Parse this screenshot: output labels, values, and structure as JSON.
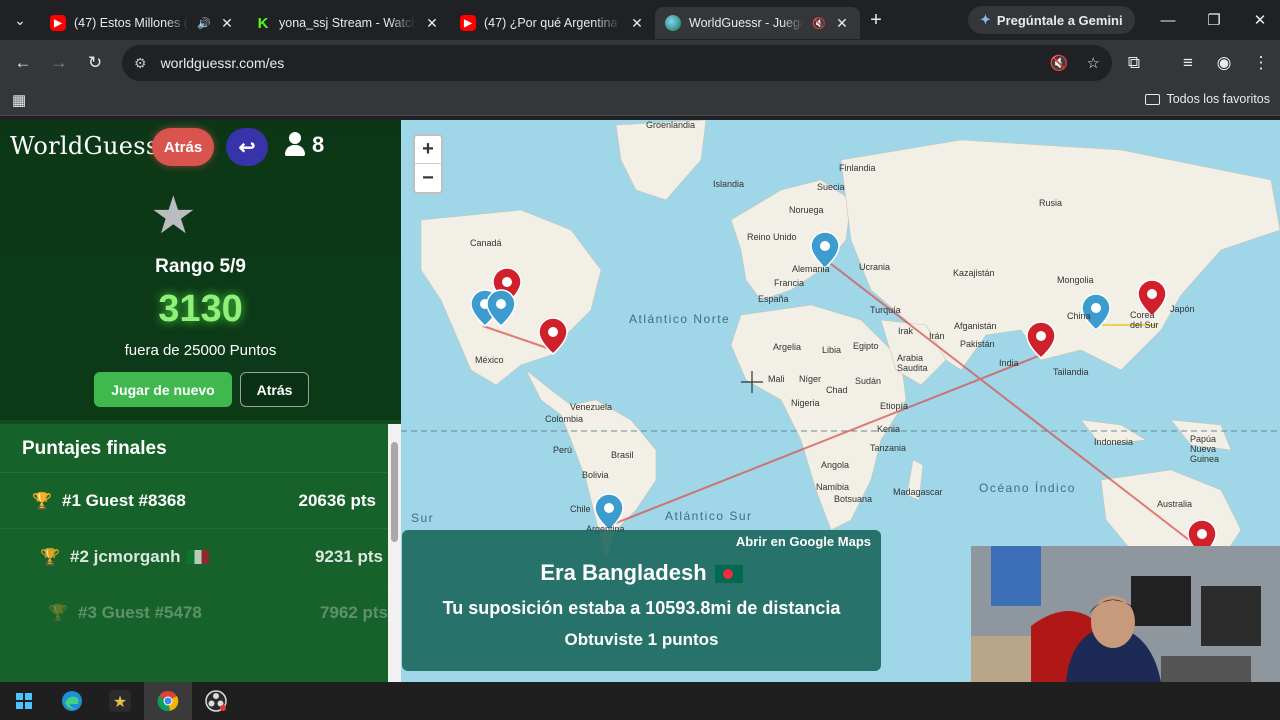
{
  "browser": {
    "tabs": [
      {
        "title": "(47) Estos Millones (Sa",
        "favicon": "youtube-icon",
        "audio": "speaker-icon"
      },
      {
        "title": "yona_ssj Stream - Watch L",
        "favicon": "kick-icon"
      },
      {
        "title": "(47) ¿Por qué Argentina e",
        "favicon": "youtube-icon"
      },
      {
        "title": "WorldGuessr - Juega G",
        "favicon": "globe-icon",
        "audio": "muted-icon",
        "active": true
      }
    ],
    "gemini_label": "Pregúntale a Gemini",
    "url": "worldguessr.com/es",
    "bookmarks_label": "Todos los favoritos"
  },
  "game": {
    "logo": "WorldGuessr",
    "back_label": "Atrás",
    "players": "8",
    "rank": "Rango 5/9",
    "score": "3130",
    "out_of": "fuera de 25000 Puntos",
    "play_again": "Jugar de nuevo",
    "back2": "Atrás",
    "final_scores_title": "Puntajes finales",
    "leaderboard": [
      {
        "rank_name": "#1 Guest #8368",
        "points": "20636 pts"
      },
      {
        "rank_name": "#2 jcmorganh",
        "points": "9231 pts"
      },
      {
        "rank_name": "#3 Guest #5478",
        "points": "7962 pts"
      }
    ]
  },
  "map": {
    "labels": {
      "groenlandia": "Groenlandia",
      "islandia": "Islandia",
      "finlandia": "Finlandia",
      "suecia": "Suecia",
      "noruega": "Noruega",
      "rusia": "Rusia",
      "reino_unido": "Reino Unido",
      "alemania": "Alemania",
      "ucrania": "Ucrania",
      "francia": "Francia",
      "espana": "España",
      "kazajistan": "Kazajistán",
      "mongolia": "Mongolia",
      "china": "China",
      "corea": "Corea del Sur",
      "japon": "Japón",
      "turquia": "Turquía",
      "irak": "Irak",
      "iran": "Irán",
      "afganistan": "Afganistán",
      "pakistan": "Pakistán",
      "india": "India",
      "tailandia": "Tailandia",
      "indonesia": "Indonesia",
      "papua": "Papúa Nueva Guinea",
      "australia": "Australia",
      "argelia": "Argelia",
      "libia": "Libia",
      "egipto": "Egipto",
      "arabia": "Arabia Saudita",
      "mali": "Mali",
      "niger": "Níger",
      "chad": "Chad",
      "sudan": "Sudán",
      "nigeria": "Nigeria",
      "etiopia": "Etiopía",
      "kenia": "Kenia",
      "tanzania": "Tanzania",
      "angola": "Angola",
      "namibia": "Namibia",
      "botsuana": "Botsuana",
      "madagascar": "Madagascar",
      "canada": "Canadá",
      "mexico": "México",
      "venezuela": "Venezuela",
      "colombia": "Colombia",
      "peru": "Perú",
      "brasil": "Brasil",
      "bolivia": "Bolivia",
      "chile": "Chile",
      "argentina": "Argentina",
      "atl_norte": "Atlántico Norte",
      "atl_sur": "Atlántico Sur",
      "oceano_indico": "Océano Índico",
      "sur": "Sur"
    }
  },
  "result": {
    "google_maps": "Abrir en Google Maps",
    "was": "Era Bangladesh",
    "distance": "Tu suposición estaba a 10593.8mi de distancia",
    "points": "Obtuviste 1 puntos"
  },
  "taskbar": [
    "windows-start-icon",
    "edge-icon",
    "star-app-icon",
    "chrome-icon",
    "obs-icon"
  ]
}
